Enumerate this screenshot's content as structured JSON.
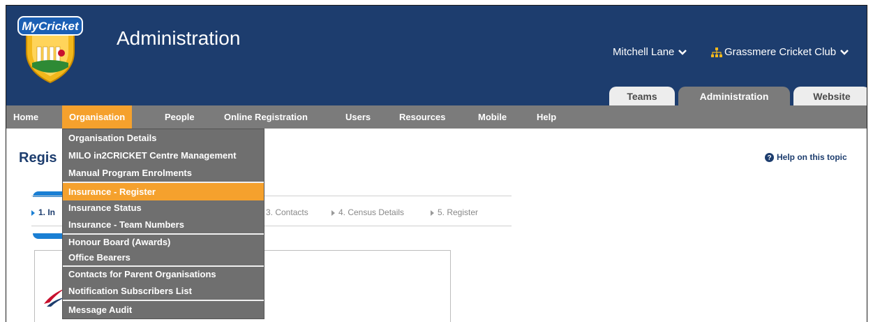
{
  "header": {
    "logo_text": "MyCricket",
    "title": "Administration",
    "user_name": "Mitchell Lane",
    "org_name": "Grassmere Cricket Club"
  },
  "tabs": [
    {
      "label": "Teams"
    },
    {
      "label": "Administration"
    },
    {
      "label": "Website"
    }
  ],
  "nav": {
    "items": [
      {
        "label": "Home"
      },
      {
        "label": "Organisation"
      },
      {
        "label": "People"
      },
      {
        "label": "Online Registration"
      },
      {
        "label": "Users"
      },
      {
        "label": "Resources"
      },
      {
        "label": "Mobile"
      },
      {
        "label": "Help"
      }
    ]
  },
  "dropdown": {
    "groups": [
      [
        "Organisation Details",
        "MILO in2CRICKET Centre Management",
        "Manual Program Enrolments"
      ],
      [
        "Insurance - Register",
        "Insurance Status",
        "Insurance - Team Numbers"
      ],
      [
        "Honour Board (Awards)",
        "Office Bearers"
      ],
      [
        "Contacts for Parent Organisations",
        "Notification Subscribers List"
      ],
      [
        "Message Audit"
      ]
    ]
  },
  "page": {
    "title_visible": "Regis",
    "help_link": "Help on this topic"
  },
  "wizard": {
    "steps": [
      "1. In",
      "3. Contacts",
      "4. Census Details",
      "5. Register"
    ]
  },
  "colors": {
    "header_bg": "#1d3d6e",
    "nav_bg": "#7b7b7b",
    "accent": "#f5a12d",
    "wizard_blue": "#1a7fd4"
  }
}
